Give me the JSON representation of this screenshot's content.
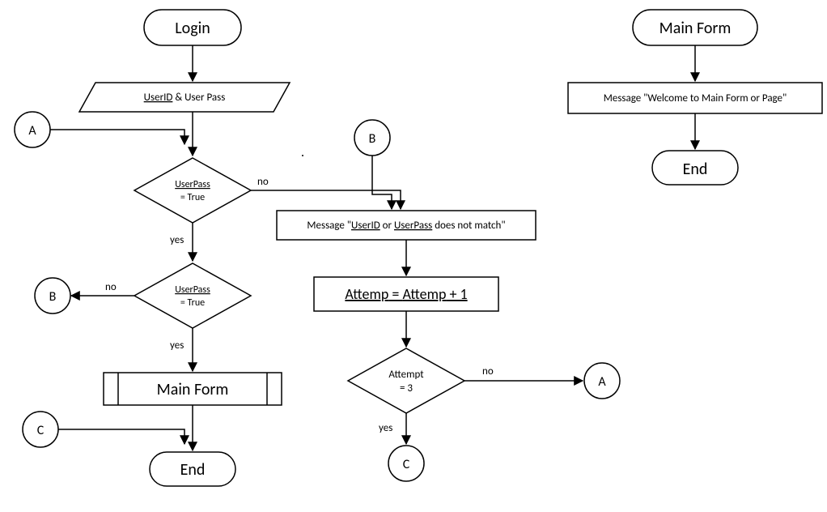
{
  "left": {
    "start": "Login",
    "input_userid": "UserID",
    "input_amp": " & User Pass",
    "conn_A": "A",
    "dec1_l1": "UserPass",
    "dec1_l2": "= True",
    "dec1_no": "no",
    "dec1_yes": "yes",
    "dec2_l1": "UserPass",
    "dec2_l2": "= True",
    "dec2_no": "no",
    "dec2_yes": "yes",
    "conn_B_left": "B",
    "sub_mainform": "Main Form",
    "conn_C_left": "C",
    "end": "End"
  },
  "mid": {
    "conn_B": "B",
    "msg_prefix": "Message \"",
    "msg_userid": "UserID",
    "msg_or": " or ",
    "msg_userpass": "UserPass",
    "msg_suffix": " does not match\"",
    "attemp_word": "Attemp",
    "attemp_eq": " = ",
    "attemp_word2": "Attemp",
    "attemp_plus": " + 1",
    "dec_l1": "Attempt",
    "dec_l2": "= 3",
    "dec_no": "no",
    "dec_yes": "yes",
    "conn_A": "A",
    "conn_C": "C"
  },
  "right": {
    "start": "Main Form",
    "msg": "Message \"Welcome to Main Form or Page\"",
    "end": "End"
  }
}
